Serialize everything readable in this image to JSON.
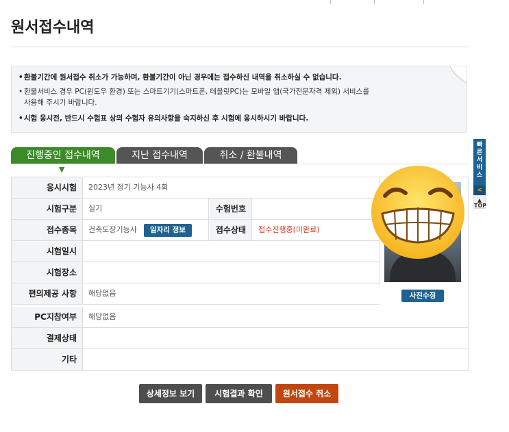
{
  "page": {
    "title": "원서접수내역"
  },
  "notice": {
    "items": [
      {
        "text": "환불기간에 원서접수 취소가 가능하며, 환불기간이 아닌 경우에는 접수하신 내역을 취소하실 수 없습니다.",
        "bold": true
      },
      {
        "text": "환불서비스 경우 PC(윈도우 환경) 또는 스마트기기(스마트폰, 테블릿PC)는 모바일 앱(국가전문자격 제외) 서비스를",
        "bold": false
      },
      {
        "text": "사용해 주시기 바랍니다.",
        "bold": false
      },
      {
        "text": "시험 응시전, 반드시 수험표 상의 수험자 유의사항을 숙지하신 후 시험에 응시하시기 바랍니다.",
        "bold": true
      }
    ]
  },
  "tabs": [
    {
      "label": "진행중인 접수내역"
    },
    {
      "label": "지난 접수내역"
    },
    {
      "label": "취소 / 환불내역"
    }
  ],
  "details": {
    "exam": {
      "label": "응시시험",
      "value": "2023년 정기 기능사 4회"
    },
    "exam_type": {
      "label": "시험구분",
      "value": "실기"
    },
    "exam_number": {
      "label": "수험번호",
      "value": ""
    },
    "subject": {
      "label": "접수종목",
      "value": "건축도장기능사"
    },
    "job_info_button": "일자리 정보",
    "status": {
      "label": "접수상태",
      "value": "접수진행중(미완료)"
    },
    "exam_date": {
      "label": "시험일시",
      "value": ""
    },
    "exam_place": {
      "label": "시험장소",
      "value": ""
    },
    "convenience": {
      "label": "편의제공 사항",
      "value": "해당없음"
    },
    "pc_bring": {
      "label": "PC지참여부",
      "value": "해당없음"
    },
    "payment": {
      "label": "결제상태",
      "value": ""
    },
    "etc": {
      "label": "기타",
      "value": ""
    },
    "photo_edit_button": "사진수정"
  },
  "buttons": {
    "detail": "상세정보 보기",
    "result": "시험결과 확인",
    "cancel": "원서접수 취소"
  },
  "side_menu": {
    "label": "빠른서비스",
    "top": "TOP"
  },
  "colors": {
    "tab_active": "#3d8a2a",
    "tab_inactive": "#555555",
    "button_blue": "#1f6290",
    "button_cancel": "#c1460f",
    "status_red": "#dd3322"
  }
}
